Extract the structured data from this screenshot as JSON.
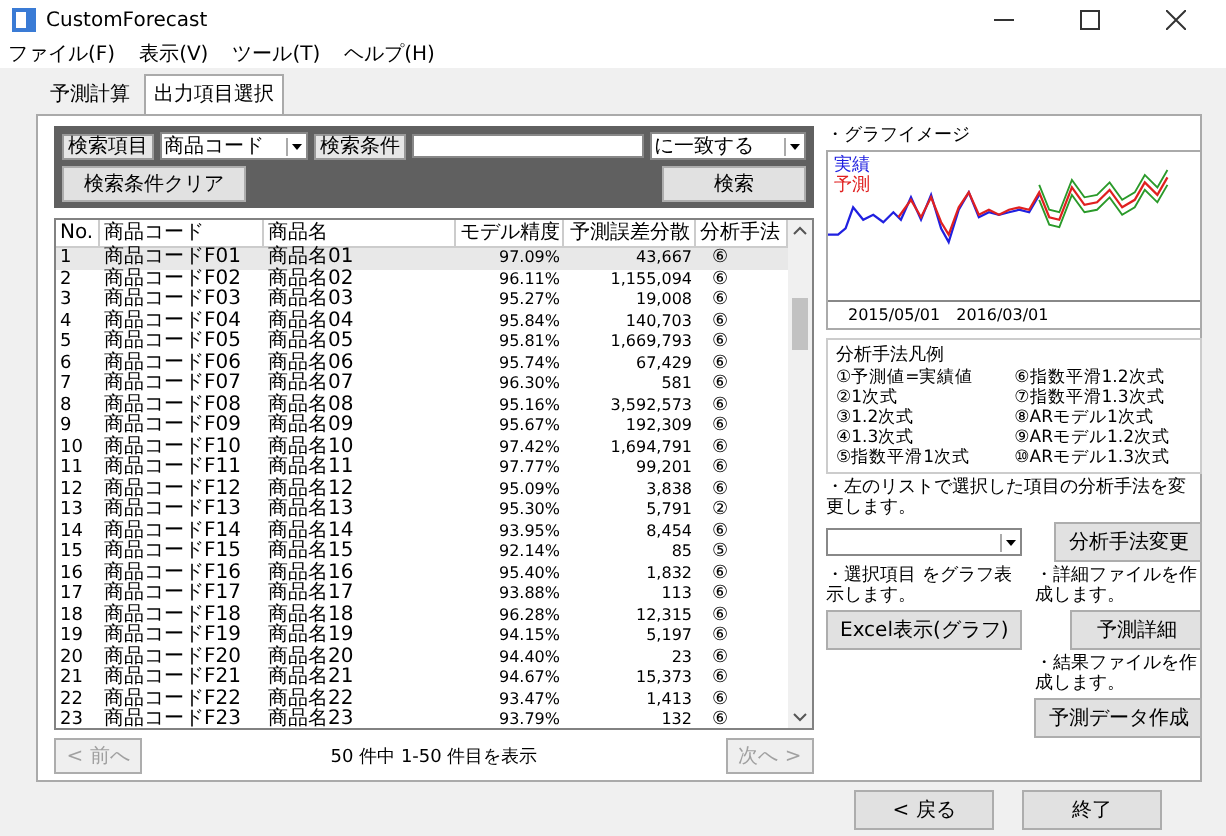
{
  "window": {
    "title": "CustomForecast"
  },
  "menu": [
    "ファイル(F)",
    "表示(V)",
    "ツール(T)",
    "ヘルプ(H)"
  ],
  "tabs": [
    {
      "label": "予測計算",
      "selected": false
    },
    {
      "label": "出力項目選択",
      "selected": true
    }
  ],
  "search": {
    "item_label": "検索項目",
    "item_value": "商品コード",
    "condition_label": "検索条件",
    "match_value": "に一致する",
    "clear_button": "検索条件クリア",
    "search_button": "検索"
  },
  "table": {
    "columns": [
      "No.",
      "商品コード",
      "商品名",
      "モデル精度",
      "予測誤差分散",
      "分析手法"
    ],
    "rows": [
      {
        "cells": [
          "1",
          "商品コードF01",
          "商品名01",
          "97.09%",
          "43,667",
          "⑥"
        ],
        "selected": true
      },
      {
        "cells": [
          "2",
          "商品コードF02",
          "商品名02",
          "96.11%",
          "1,155,094",
          "⑥"
        ],
        "selected": false
      },
      {
        "cells": [
          "3",
          "商品コードF03",
          "商品名03",
          "95.27%",
          "19,008",
          "⑥"
        ],
        "selected": false
      },
      {
        "cells": [
          "4",
          "商品コードF04",
          "商品名04",
          "95.84%",
          "140,703",
          "⑥"
        ],
        "selected": false
      },
      {
        "cells": [
          "5",
          "商品コードF05",
          "商品名05",
          "95.81%",
          "1,669,793",
          "⑥"
        ],
        "selected": false
      },
      {
        "cells": [
          "6",
          "商品コードF06",
          "商品名06",
          "95.74%",
          "67,429",
          "⑥"
        ],
        "selected": false
      },
      {
        "cells": [
          "7",
          "商品コードF07",
          "商品名07",
          "96.30%",
          "581",
          "⑥"
        ],
        "selected": false
      },
      {
        "cells": [
          "8",
          "商品コードF08",
          "商品名08",
          "95.16%",
          "3,592,573",
          "⑥"
        ],
        "selected": false
      },
      {
        "cells": [
          "9",
          "商品コードF09",
          "商品名09",
          "95.67%",
          "192,309",
          "⑥"
        ],
        "selected": false
      },
      {
        "cells": [
          "10",
          "商品コードF10",
          "商品名10",
          "97.42%",
          "1,694,791",
          "⑥"
        ],
        "selected": false
      },
      {
        "cells": [
          "11",
          "商品コードF11",
          "商品名11",
          "97.77%",
          "99,201",
          "⑥"
        ],
        "selected": false
      },
      {
        "cells": [
          "12",
          "商品コードF12",
          "商品名12",
          "95.09%",
          "3,838",
          "⑥"
        ],
        "selected": false
      },
      {
        "cells": [
          "13",
          "商品コードF13",
          "商品名13",
          "95.30%",
          "5,791",
          "②"
        ],
        "selected": false
      },
      {
        "cells": [
          "14",
          "商品コードF14",
          "商品名14",
          "93.95%",
          "8,454",
          "⑥"
        ],
        "selected": false
      },
      {
        "cells": [
          "15",
          "商品コードF15",
          "商品名15",
          "92.14%",
          "85",
          "⑤"
        ],
        "selected": false
      },
      {
        "cells": [
          "16",
          "商品コードF16",
          "商品名16",
          "95.40%",
          "1,832",
          "⑥"
        ],
        "selected": false
      },
      {
        "cells": [
          "17",
          "商品コードF17",
          "商品名17",
          "93.88%",
          "113",
          "⑥"
        ],
        "selected": false
      },
      {
        "cells": [
          "18",
          "商品コードF18",
          "商品名18",
          "96.28%",
          "12,315",
          "⑥"
        ],
        "selected": false
      },
      {
        "cells": [
          "19",
          "商品コードF19",
          "商品名19",
          "94.15%",
          "5,197",
          "⑥"
        ],
        "selected": false
      },
      {
        "cells": [
          "20",
          "商品コードF20",
          "商品名20",
          "94.40%",
          "23",
          "⑥"
        ],
        "selected": false
      },
      {
        "cells": [
          "21",
          "商品コードF21",
          "商品名21",
          "94.67%",
          "15,373",
          "⑥"
        ],
        "selected": false
      },
      {
        "cells": [
          "22",
          "商品コードF22",
          "商品名22",
          "93.47%",
          "1,413",
          "⑥"
        ],
        "selected": false
      },
      {
        "cells": [
          "23",
          "商品コードF23",
          "商品名23",
          "93.79%",
          "132",
          "⑥"
        ],
        "selected": false
      }
    ]
  },
  "pager": {
    "prev": {
      "label": "< 前へ",
      "disabled": true
    },
    "info": "50 件中 1-50 件目を表示",
    "next": {
      "label": "次へ >",
      "disabled": true
    }
  },
  "graph": {
    "title": "・グラフイメージ",
    "legend": [
      {
        "label": "実績",
        "color": "#2020e0"
      },
      {
        "label": "予測",
        "color": "#e02020"
      }
    ],
    "dates": [
      "2015/05/01",
      "2016/03/01"
    ]
  },
  "methods": {
    "title": "分析手法凡例",
    "items": [
      "①予測値=実績値",
      "⑥指数平滑1.2次式",
      "②1次式",
      "⑦指数平滑1.3次式",
      "③1.2次式",
      "⑧ARモデル1次式",
      "④1.3次式",
      "⑨ARモデル1.2次式",
      "⑤指数平滑1次式",
      "⑩ARモデル1.3次式"
    ]
  },
  "change": {
    "note": "・左のリストで選択した項目の分析手法を変更します。",
    "button": "分析手法変更"
  },
  "actions": [
    {
      "note": "・選択項目 をグラフ表示します。",
      "button": "Excel表示(グラフ)"
    },
    {
      "note": "・詳細ファイルを作成します。",
      "button": "予測詳細"
    },
    {
      "note": "・結果ファイルを作成します。",
      "button": "予測データ作成"
    }
  ],
  "footer": [
    "< 戻る",
    "終了"
  ]
}
